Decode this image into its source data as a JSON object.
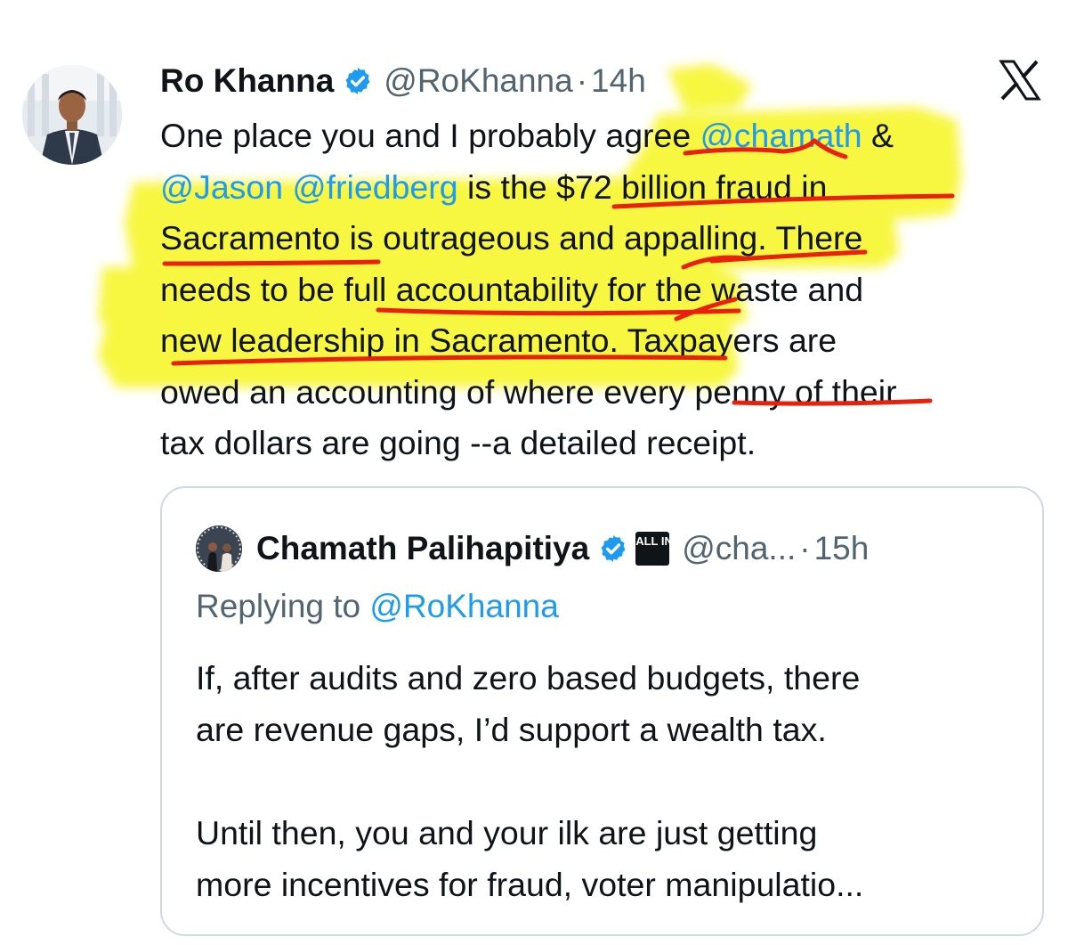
{
  "tweet": {
    "author_name": "Ro Khanna",
    "handle": "@RoKhanna",
    "separator": "·",
    "time": "14h",
    "verified_icon": "verified-badge-icon",
    "platform_icon": "x-logo-icon",
    "lines": [
      [
        "One place you and I probably agree ",
        {
          "m": "@chamath"
        },
        " &"
      ],
      [
        {
          "m": "@Jason @friedberg"
        },
        " is the $72 billion fraud in"
      ],
      [
        "Sacramento is outrageous and appalling. There"
      ],
      [
        "needs to be full accountability for the waste and"
      ],
      [
        "new leadership in Sacramento. Taxpayers are"
      ],
      [
        "owed an accounting of where every penny of their"
      ],
      [
        "tax dollars are going --a detailed receipt."
      ]
    ]
  },
  "quoted": {
    "author_name": "Chamath Palihapitiya",
    "badge_text": "ALL IN",
    "handle": "@cha...",
    "separator": "·",
    "time": "15h",
    "reply_prefix": "Replying to ",
    "reply_handle": "@RoKhanna",
    "body_lines": [
      "If, after audits and zero based budgets, there",
      "are revenue gaps, I’d support a wealth tax.",
      "",
      "Until then, you and your ilk are just getting",
      "more incentives for fraud, voter manipulatio..."
    ]
  },
  "colors": {
    "text": "#0f1419",
    "secondary": "#536471",
    "link": "#1d9bf0",
    "verified": "#1d9bf0",
    "highlighter": "#f6f526",
    "pen": "#e8200c",
    "border": "#cfd9de"
  }
}
